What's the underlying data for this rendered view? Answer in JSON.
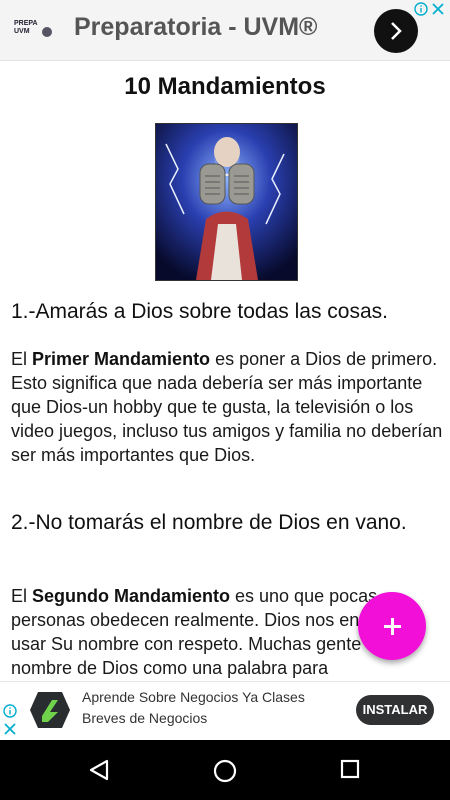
{
  "top_ad": {
    "logo_text": "PREPA UVM",
    "title": "Preparatoria - UVM®"
  },
  "page": {
    "title": "10 Mandamientos"
  },
  "sections": [
    {
      "heading": "1.-Amarás a Dios sobre todas las cosas.",
      "para_prefix": "El ",
      "para_bold": "Primer Mandamiento",
      "para_rest": " es poner a Dios de primero. Esto significa que nada debería ser más importante que Dios-un hobby que te gusta, la televisión o los video juegos, incluso tus amigos y familia no deberían ser más importantes que Dios."
    },
    {
      "heading": "2.-No tomarás el nombre de Dios en vano.",
      "para_prefix": "El ",
      "para_bold": "Segundo Mandamiento",
      "para_rest": " es uno que pocas personas obedecen realmente. Dios nos enseña a usar Su nombre con respeto. Muchas gente usa el nombre de Dios como una palabra para"
    }
  ],
  "bottom_ad": {
    "line1": "Aprende Sobre Negocios Ya Clases",
    "line2": "Breves de Negocios",
    "install_label": "INSTALAR"
  },
  "colors": {
    "fab": "#f20fd8",
    "ad_info_blue": "#00aecd",
    "install_button": "#2f3133"
  },
  "icons": [
    "arrow-right-icon",
    "ad-info-icon",
    "ad-close-icon",
    "plus-icon",
    "back-icon",
    "home-icon",
    "recents-icon"
  ]
}
